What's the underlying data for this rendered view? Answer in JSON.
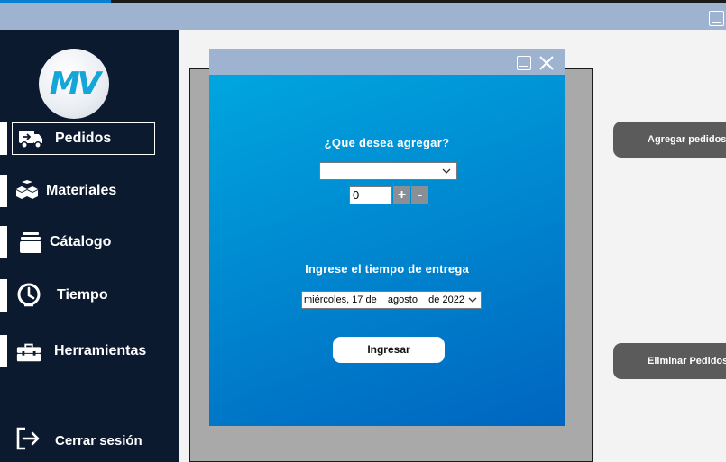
{
  "window": {
    "minimize_icon": "minimize-icon"
  },
  "logo": {
    "text": "MV",
    "color": "#14a6d6"
  },
  "sidebar": {
    "items": [
      {
        "label": "Pedidos",
        "icon": "truck-icon",
        "active": true
      },
      {
        "label": "Materiales",
        "icon": "boxes-icon",
        "active": false
      },
      {
        "label": "Cátalogo",
        "icon": "stack-icon",
        "active": false
      },
      {
        "label": "Tiempo",
        "icon": "clock-icon",
        "active": false
      },
      {
        "label": "Herramientas",
        "icon": "toolbox-icon",
        "active": false
      }
    ],
    "logout": {
      "label": "Cerrar sesión",
      "icon": "logout-icon"
    }
  },
  "dialog": {
    "question": "¿Que desea agregar?",
    "select_value": "",
    "quantity_value": "0",
    "increment_label": "+",
    "decrement_label": "-",
    "delivery_label": "Ingrese el tiempo de entrega",
    "date_value": "miércoles, 17 de    agosto    de 2022",
    "submit_label": "Ingresar"
  },
  "actions": {
    "add_label": "Agregar pedidos",
    "delete_label": "Eliminar Pedidos"
  },
  "colors": {
    "sidebar_bg": "#0c1a30",
    "titlebar_bg": "#9db3d0",
    "dialog_gradient_start": "#00a6df",
    "dialog_gradient_end": "#0065c0",
    "action_button_bg": "#5b5b5b"
  }
}
